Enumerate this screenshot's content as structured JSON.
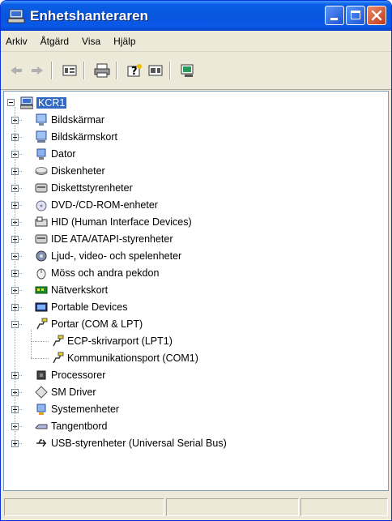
{
  "window": {
    "title": "Enhetshanteraren"
  },
  "menu": [
    "Arkiv",
    "Åtgärd",
    "Visa",
    "Hjälp"
  ],
  "toolbar": {
    "items": [
      "back-icon",
      "forward-icon",
      "properties-icon",
      "print-icon",
      "help-icon",
      "details-icon",
      "scan-hardware-icon"
    ]
  },
  "tree": {
    "root": "KCR1",
    "items": [
      {
        "label": "Bildskärmar",
        "icon": "monitor-icon",
        "expanded": false
      },
      {
        "label": "Bildskärmskort",
        "icon": "display-adapter-icon",
        "expanded": false
      },
      {
        "label": "Dator",
        "icon": "computer-icon",
        "expanded": false
      },
      {
        "label": "Diskenheter",
        "icon": "disk-drive-icon",
        "expanded": false
      },
      {
        "label": "Diskettstyrenheter",
        "icon": "floppy-controller-icon",
        "expanded": false
      },
      {
        "label": "DVD-/CD-ROM-enheter",
        "icon": "cdrom-icon",
        "expanded": false
      },
      {
        "label": "HID (Human Interface Devices)",
        "icon": "hid-icon",
        "expanded": false
      },
      {
        "label": "IDE ATA/ATAPI-styrenheter",
        "icon": "ide-controller-icon",
        "expanded": false
      },
      {
        "label": "Ljud-, video- och spelenheter",
        "icon": "sound-icon",
        "expanded": false
      },
      {
        "label": "Möss och andra pekdon",
        "icon": "mouse-icon",
        "expanded": false
      },
      {
        "label": "Nätverkskort",
        "icon": "network-card-icon",
        "expanded": false
      },
      {
        "label": "Portable Devices",
        "icon": "portable-device-icon",
        "expanded": false
      },
      {
        "label": "Portar (COM & LPT)",
        "icon": "port-icon",
        "expanded": true,
        "children": [
          "ECP-skrivarport (LPT1)",
          "Kommunikationsport (COM1)"
        ]
      },
      {
        "label": "Processorer",
        "icon": "processor-icon",
        "expanded": false
      },
      {
        "label": "SM Driver",
        "icon": "sm-driver-icon",
        "expanded": false
      },
      {
        "label": "Systemenheter",
        "icon": "system-devices-icon",
        "expanded": false
      },
      {
        "label": "Tangentbord",
        "icon": "keyboard-icon",
        "expanded": false
      },
      {
        "label": "USB-styrenheter (Universal Serial Bus)",
        "icon": "usb-icon",
        "expanded": false
      }
    ]
  },
  "colors": {
    "titlebar": "#0855dd",
    "selection": "#316ac5",
    "chrome": "#ece9d8"
  }
}
